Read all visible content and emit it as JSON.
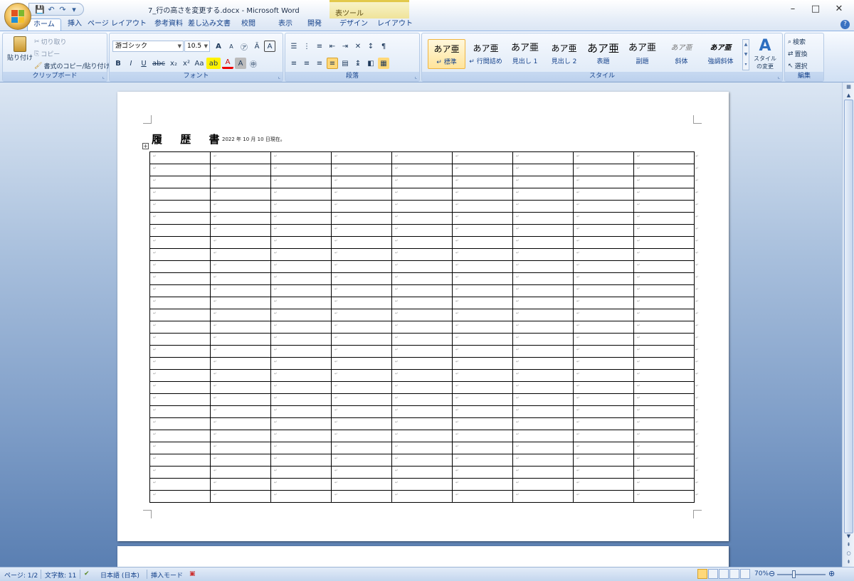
{
  "window": {
    "doc_title": "7_行の高さを変更する.docx - Microsoft Word",
    "context_tools": "表ツール",
    "minimize": "–",
    "maximize": "□",
    "close": "✕"
  },
  "qat": [
    "save-icon",
    "undo-icon",
    "redo-icon",
    "customize-icon"
  ],
  "tabs": [
    "ホーム",
    "挿入",
    "ページ レイアウト",
    "参考資料",
    "差し込み文書",
    "校閲",
    "表示",
    "開発",
    "デザイン",
    "レイアウト"
  ],
  "ribbon": {
    "clipboard": {
      "label": "クリップボード",
      "paste": "貼り付け",
      "cut": "切り取り",
      "copy": "コピー",
      "format_painter": "書式のコピー/貼り付け"
    },
    "font": {
      "label": "フォント",
      "font_name": "游ゴシック",
      "font_size": "10.5",
      "bold": "B",
      "italic": "I",
      "underline": "U",
      "strike": "abc",
      "subscript": "x₂",
      "superscript": "x²",
      "change_case": "Aa",
      "grow": "A",
      "shrink": "A"
    },
    "paragraph": {
      "label": "段落"
    },
    "styles": {
      "label": "スタイル",
      "items": [
        {
          "preview": "あア亜",
          "name": "↵ 標準"
        },
        {
          "preview": "あア亜",
          "name": "↵ 行間詰め"
        },
        {
          "preview": "あア亜",
          "name": "見出し 1"
        },
        {
          "preview": "あア亜",
          "name": "見出し 2"
        },
        {
          "preview": "あア亜",
          "name": "表題"
        },
        {
          "preview": "あア亜",
          "name": "副題"
        },
        {
          "preview": "あア亜",
          "name": "斜体"
        },
        {
          "preview": "あア亜",
          "name": "強調斜体"
        }
      ],
      "change_styles": "スタイルの変更"
    },
    "editing": {
      "label": "編集",
      "find": "検索",
      "replace": "置換",
      "select": "選択"
    }
  },
  "document": {
    "heading": "履 歴 書",
    "date": "2022 年 10 月 10 日現在。",
    "table_handle": "+",
    "cell_mark": "↵",
    "rows": 29,
    "cols": 9
  },
  "status": {
    "page": "ページ: 1/2",
    "words": "文字数: 11",
    "language": "日本語 (日本)",
    "mode": "挿入モード",
    "zoom": "70%",
    "zoom_value": 0.7
  },
  "colors": {
    "accent": "#15428b",
    "ribbon": "#dbe6f4",
    "context": "#efe39a"
  }
}
